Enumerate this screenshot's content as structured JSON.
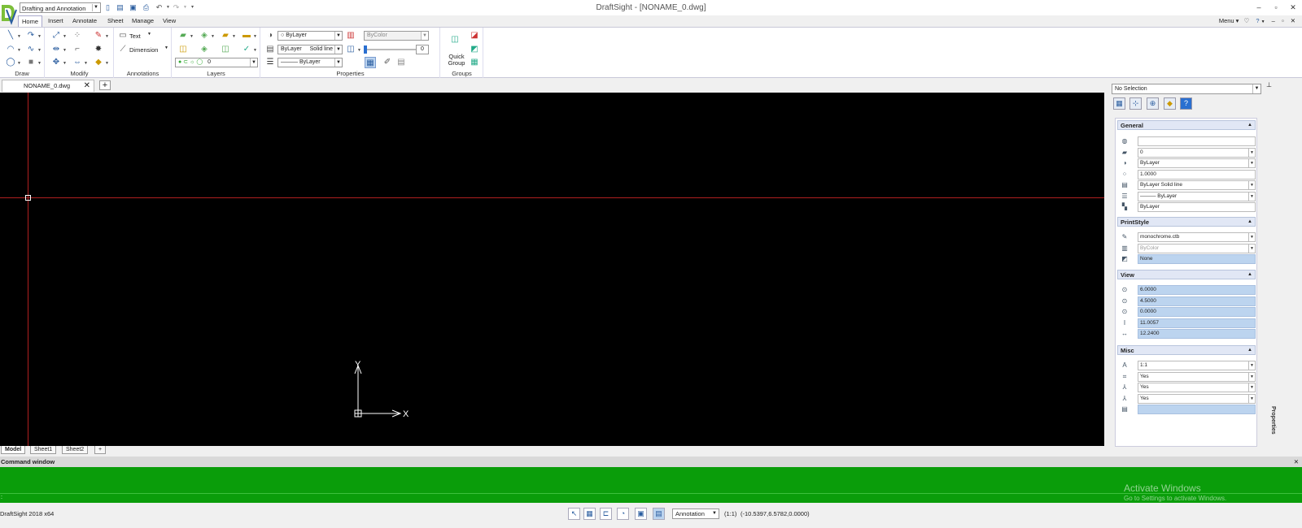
{
  "titlebar": {
    "workspace": "Drafting and Annotation",
    "title": "DraftSight - [NONAME_0.dwg]"
  },
  "menu_tabs": [
    "Home",
    "Insert",
    "Annotate",
    "Sheet",
    "Manage",
    "View"
  ],
  "right_menu": "Menu ▾",
  "ribbon": {
    "groups": {
      "draw": "Draw",
      "modify": "Modify",
      "annotations": "Annotations",
      "layers": "Layers",
      "properties": "Properties",
      "groups": "Groups"
    },
    "text_label": "Text",
    "dimension_label": "Dimension",
    "layer_value": "0",
    "color_value": "ByLayer",
    "linestyle_value": "ByLayer",
    "linestyle_name": "Solid line",
    "lineweight_value": "——— ByLayer",
    "printstyle_value": "ByColor",
    "transparency_value": "0",
    "quick_group": "Quick Group"
  },
  "document_tab": "NONAME_0.dwg",
  "sheet_tabs": [
    "Model",
    "Sheet1",
    "Sheet2"
  ],
  "canvas": {
    "ucs_x": "X",
    "ucs_y": "Y"
  },
  "properties_panel": {
    "selection": "No Selection",
    "vertical_tab": "Properties",
    "sections": {
      "general": {
        "title": "General",
        "rows": [
          "",
          "0",
          "ByLayer",
          "1.0000",
          "ByLayer     Solid line",
          "——— ByLayer",
          "ByLayer"
        ]
      },
      "printstyle": {
        "title": "PrintStyle",
        "rows": [
          "monochrome.ctb",
          "ByColor",
          "None"
        ]
      },
      "view": {
        "title": "View",
        "rows": [
          "6.0000",
          "4.5000",
          "0.0000",
          "11.0057",
          "12.2400"
        ]
      },
      "misc": {
        "title": "Misc",
        "rows": [
          "1:1",
          "Yes",
          "Yes",
          "Yes",
          ""
        ]
      }
    }
  },
  "command_window": {
    "title": "Command window",
    "prompt": ":"
  },
  "watermark": {
    "line1": "Activate Windows",
    "line2": "Go to Settings to activate Windows."
  },
  "statusbar": {
    "app": "DraftSight 2018 x64",
    "annotation": "Annotation",
    "scale": "(1:1)",
    "coords": "(-10.5397,6.5782,0.0000)"
  }
}
